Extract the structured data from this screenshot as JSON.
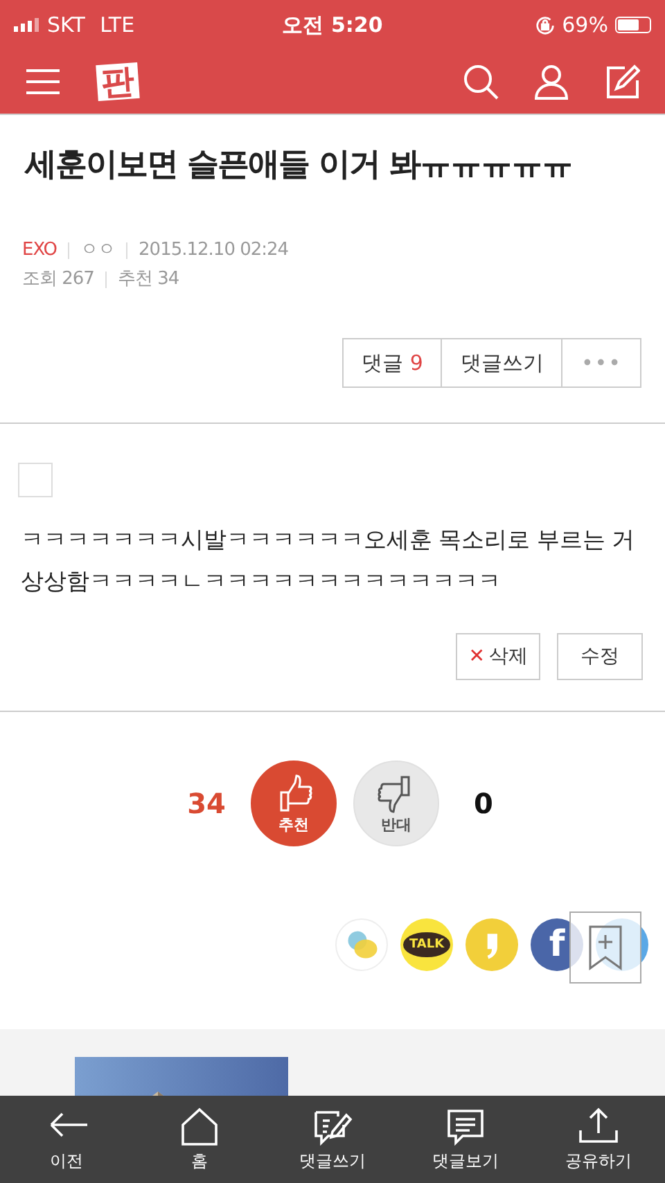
{
  "status_bar": {
    "carrier": "SKT",
    "network": "LTE",
    "time": "오전 5:20",
    "battery": "69%"
  },
  "header": {
    "logo": "판"
  },
  "post": {
    "title": "세훈이보면 슬픈애들 이거 봐ㅠㅠㅠㅠㅠ",
    "category": "EXO",
    "author": "ㅇㅇ",
    "date": "2015.12.10 02:24",
    "views": "조회 267",
    "recommends": "추천 34"
  },
  "actions": {
    "comment_label": "댓글",
    "comment_count": "9",
    "write": "댓글쓰기",
    "more": "•••"
  },
  "attachment_checkbox": {
    "checked": false
  },
  "body": "ㅋㅋㅋㅋㅋㅋㅋ시발ㅋㅋㅋㅋㅋㅋ오세훈 목소리로 부르는 거 상상함ㅋㅋㅋㅋㄴㅋㅋㅋㅋㅋㅋㅋㅋㅋㅋㅋㅋㅋ",
  "edit_buttons": [
    {
      "kind": "delete",
      "icon": "✕",
      "label": "삭제"
    },
    {
      "kind": "edit",
      "label": "수정"
    }
  ],
  "vote": {
    "up_count": "34",
    "up_label": "추천",
    "up_selected": true,
    "down_label": "반대",
    "down_selected": false,
    "down_count": "0"
  },
  "share": [
    {
      "kind": "chat"
    },
    {
      "kind": "talk",
      "label": "TALK"
    },
    {
      "kind": "story"
    },
    {
      "kind": "facebook",
      "label": "f"
    },
    {
      "kind": "twitter"
    }
  ],
  "bottom_nav": [
    {
      "kind": "back",
      "label": "이전"
    },
    {
      "kind": "home",
      "label": "홈"
    },
    {
      "kind": "write",
      "label": "댓글쓰기"
    },
    {
      "kind": "comments",
      "label": "댓글보기"
    },
    {
      "kind": "share",
      "label": "공유하기"
    }
  ]
}
